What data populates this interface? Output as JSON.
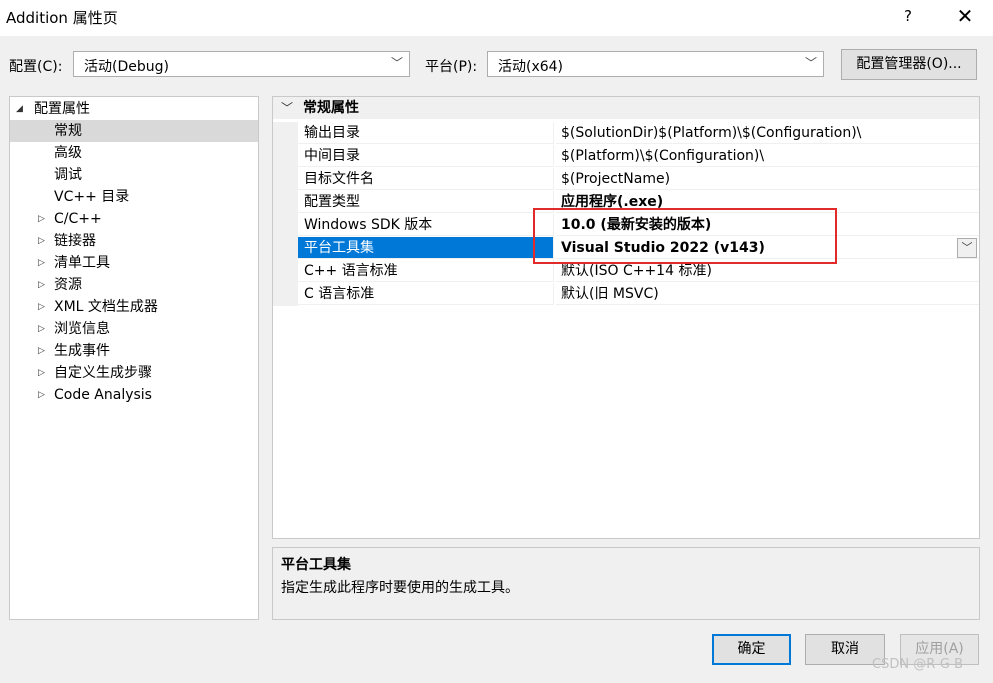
{
  "window": {
    "title": "Addition 属性页",
    "help_label": "?",
    "close_label": "✕"
  },
  "toolbar": {
    "config_label": "配置(C):",
    "config_value": "活动(Debug)",
    "platform_label": "平台(P):",
    "platform_value": "活动(x64)",
    "config_manager_label": "配置管理器(O)..."
  },
  "tree": {
    "root": "配置属性",
    "items": [
      {
        "label": "常规",
        "expandable": false,
        "selected": true
      },
      {
        "label": "高级",
        "expandable": false
      },
      {
        "label": "调试",
        "expandable": false
      },
      {
        "label": "VC++ 目录",
        "expandable": false
      },
      {
        "label": "C/C++",
        "expandable": true
      },
      {
        "label": "链接器",
        "expandable": true
      },
      {
        "label": "清单工具",
        "expandable": true
      },
      {
        "label": "资源",
        "expandable": true
      },
      {
        "label": "XML 文档生成器",
        "expandable": true
      },
      {
        "label": "浏览信息",
        "expandable": true
      },
      {
        "label": "生成事件",
        "expandable": true
      },
      {
        "label": "自定义生成步骤",
        "expandable": true
      },
      {
        "label": "Code Analysis",
        "expandable": true
      }
    ]
  },
  "grid": {
    "category": "常规属性",
    "rows": [
      {
        "name": "输出目录",
        "value": "$(SolutionDir)$(Platform)\\$(Configuration)\\",
        "bold": false
      },
      {
        "name": "中间目录",
        "value": "$(Platform)\\$(Configuration)\\",
        "bold": false
      },
      {
        "name": "目标文件名",
        "value": "$(ProjectName)",
        "bold": false
      },
      {
        "name": "配置类型",
        "value": "应用程序(.exe)",
        "bold": true
      },
      {
        "name": "Windows SDK 版本",
        "value": "10.0 (最新安装的版本)",
        "bold": true
      },
      {
        "name": "平台工具集",
        "value": "Visual Studio 2022 (v143)",
        "bold": true,
        "selected": true
      },
      {
        "name": "C++ 语言标准",
        "value": "默认(ISO C++14 标准)",
        "bold": false
      },
      {
        "name": "C 语言标准",
        "value": "默认(旧 MSVC)",
        "bold": false
      }
    ]
  },
  "description": {
    "title": "平台工具集",
    "text": "指定生成此程序时要使用的生成工具。"
  },
  "buttons": {
    "ok": "确定",
    "cancel": "取消",
    "apply": "应用(A)"
  },
  "watermark": "CSDN @R-G-B",
  "colors": {
    "selection": "#0078d7",
    "highlight_box": "#e12b2b"
  }
}
